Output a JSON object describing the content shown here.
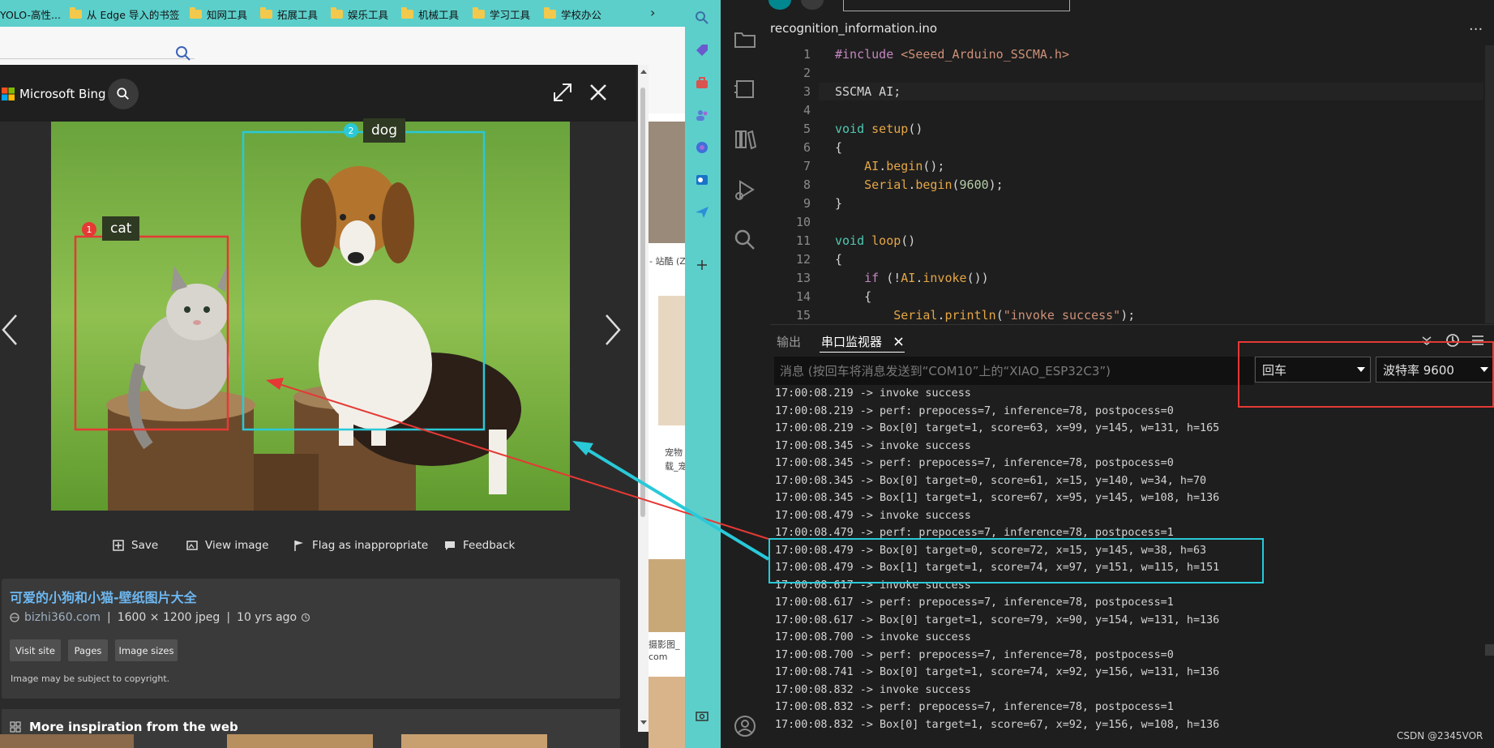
{
  "favorites": {
    "items": [
      {
        "label": "YOLO-高性..."
      },
      {
        "label": "从 Edge 导入的书签"
      },
      {
        "label": "知网工具"
      },
      {
        "label": "拓展工具"
      },
      {
        "label": "娱乐工具"
      },
      {
        "label": "机械工具"
      },
      {
        "label": "学习工具"
      },
      {
        "label": "学校办公"
      }
    ],
    "more": "›"
  },
  "bing": {
    "brand": "Microsoft Bing",
    "labels": {
      "cat": "cat",
      "dog": "dog",
      "cat_num": "1",
      "dog_num": "2"
    },
    "actions": {
      "save": "Save",
      "view": "View image",
      "flag": "Flag as inappropriate",
      "feedback": "Feedback"
    },
    "result": {
      "title": "可爱的小狗和小猫-壁纸图片大全",
      "domain": "bizhi360.com",
      "size": "1600 × 1200 jpeg",
      "age": "10 yrs ago",
      "buttons": {
        "visit": "Visit site",
        "pages": "Pages",
        "sizes": "Image sizes"
      },
      "copyright": "Image may be subject to copyright."
    },
    "more_inspiration": "More inspiration from the web"
  },
  "behind_page": {
    "snippets": [
      "- 站酷 (Z",
      "宠物",
      "载_宠",
      "摄影图_",
      "com"
    ]
  },
  "ide": {
    "file_tab": "recognition_information.ino",
    "line_numbers": [
      "1",
      "2",
      "3",
      "4",
      "5",
      "6",
      "7",
      "8",
      "9",
      "10",
      "11",
      "12",
      "13",
      "14",
      "15"
    ],
    "panel": {
      "output_tab": "输出",
      "serial_tab": "串口监视器",
      "message_placeholder": "消息 (按回车将消息发送到“COM10”上的“XIAO_ESP32C3”)",
      "line_ending": "回车",
      "baud": "波特率 9600"
    },
    "serial_lines": [
      "17:00:08.219 -> invoke success",
      "17:00:08.219 -> perf: prepocess=7, inference=78, postpocess=0",
      "17:00:08.219 -> Box[0] target=1, score=63, x=99, y=145, w=131, h=165",
      "17:00:08.345 -> invoke success",
      "17:00:08.345 -> perf: prepocess=7, inference=78, postpocess=0",
      "17:00:08.345 -> Box[0] target=0, score=61, x=15, y=140, w=34, h=70",
      "17:00:08.345 -> Box[1] target=1, score=67, x=95, y=145, w=108, h=136",
      "17:00:08.479 -> invoke success",
      "17:00:08.479 -> perf: prepocess=7, inference=78, postpocess=1",
      "17:00:08.479 -> Box[0] target=0, score=72, x=15, y=145, w=38, h=63",
      "17:00:08.479 -> Box[1] target=1, score=74, x=97, y=151, w=115, h=151",
      "17:00:08.617 -> invoke success",
      "17:00:08.617 -> perf: prepocess=7, inference=78, postpocess=1",
      "17:00:08.617 -> Box[0] target=1, score=79, x=90, y=154, w=131, h=136",
      "17:00:08.700 -> invoke success",
      "17:00:08.700 -> perf: prepocess=7, inference=78, postpocess=0",
      "17:00:08.741 -> Box[0] target=1, score=74, x=92, y=156, w=131, h=136",
      "17:00:08.832 -> invoke success",
      "17:00:08.832 -> perf: prepocess=7, inference=78, postpocess=1",
      "17:00:08.832 -> Box[0] target=1, score=67, x=92, y=156, w=108, h=136"
    ]
  },
  "watermark": "CSDN @2345VOR",
  "colors": {
    "cyan": "#29c9d8",
    "red": "#e53935",
    "favbar": "#5ccfcb"
  }
}
